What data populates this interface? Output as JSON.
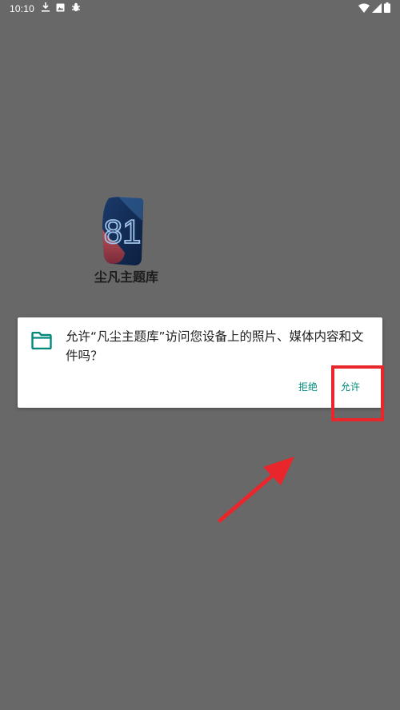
{
  "status_bar": {
    "time": "10:10",
    "left_icons": [
      "download-icon",
      "image-icon",
      "bug-icon"
    ],
    "right_icons": [
      "wifi-icon",
      "signal-icon",
      "battery-icon"
    ]
  },
  "app": {
    "name": "尘凡主题库",
    "logo_text": "81"
  },
  "dialog": {
    "icon": "folder-icon",
    "message": "允许“凡尘主题库”访问您设备上的照片、媒体内容和文件吗？",
    "deny_label": "拒绝",
    "allow_label": "允许"
  },
  "colors": {
    "background": "#686868",
    "accent": "#00897b",
    "annotation": "#e8262c"
  }
}
